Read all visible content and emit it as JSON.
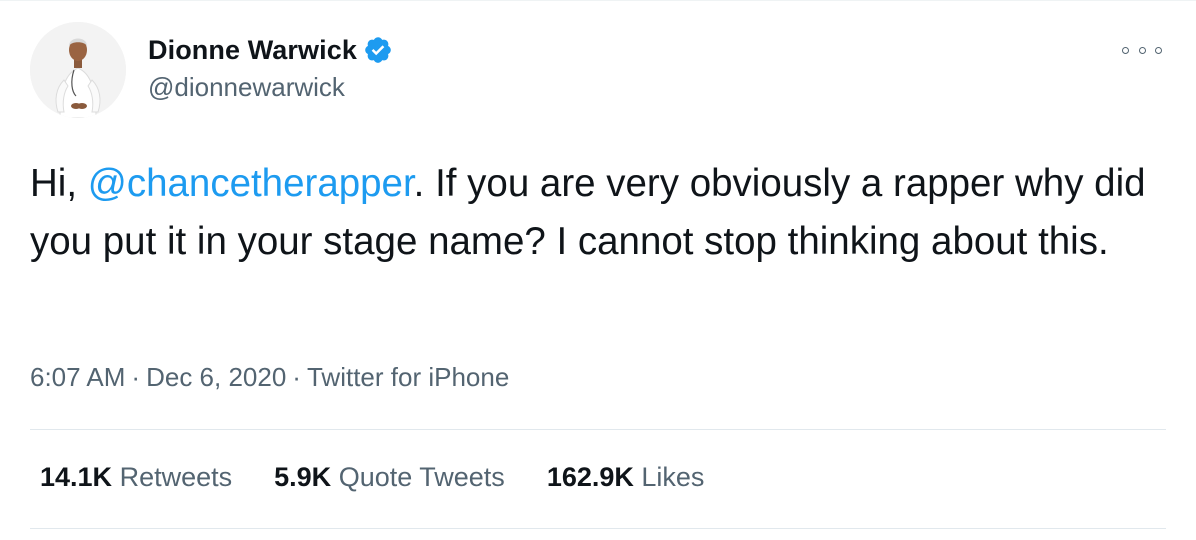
{
  "author": {
    "name": "Dionne Warwick",
    "handle": "@dionnewarwick",
    "verified": true
  },
  "tweet": {
    "text_before": "Hi, ",
    "mention": "@chancetherapper",
    "text_after": ". If you are very obviously a rapper why did you put it in your stage name? I cannot stop thinking about this.",
    "time": "6:07 AM",
    "separator": "·",
    "date": "Dec 6, 2020",
    "source": "Twitter for iPhone"
  },
  "stats": {
    "retweets_count": "14.1K",
    "retweets_label": "Retweets",
    "quotes_count": "5.9K",
    "quotes_label": "Quote Tweets",
    "likes_count": "162.9K",
    "likes_label": "Likes"
  },
  "colors": {
    "accent": "#1d9bf0",
    "text": "#0f1419",
    "secondary": "#536471"
  },
  "icons": {
    "verified": "verified-badge-icon",
    "more": "more-options-icon"
  }
}
